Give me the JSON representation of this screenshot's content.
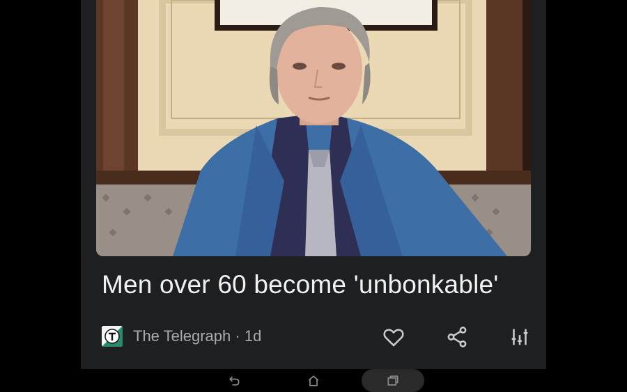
{
  "article": {
    "headline": "Men over 60 become 'unbonkable'",
    "source": "The Telegraph",
    "separator": "·",
    "age": "1d",
    "source_icon": "telegraph-logo-icon",
    "image_subject": "photo-man-in-blue-suit"
  },
  "actions": {
    "like_icon": "heart-icon",
    "share_icon": "share-icon",
    "adjust_icon": "sliders-icon"
  },
  "navbar": {
    "back_icon": "back-icon",
    "home_icon": "home-icon",
    "recent_icon": "recent-apps-icon"
  },
  "colors": {
    "card_bg": "#1e1f21",
    "headline": "#f1f1f1",
    "meta_text": "#a9abae",
    "icon": "#c9cbcf",
    "suit": "#3e6ea6"
  }
}
